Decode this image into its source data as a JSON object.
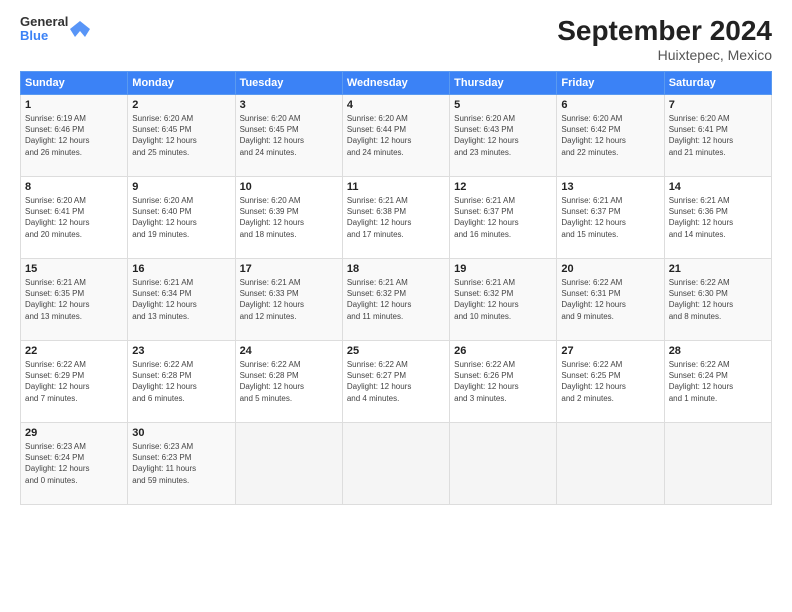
{
  "logo": {
    "text_general": "General",
    "text_blue": "Blue"
  },
  "header": {
    "month_title": "September 2024",
    "location": "Huixtepec, Mexico"
  },
  "days_header": [
    "Sunday",
    "Monday",
    "Tuesday",
    "Wednesday",
    "Thursday",
    "Friday",
    "Saturday"
  ],
  "weeks": [
    [
      {
        "day": "1",
        "sunrise": "6:19 AM",
        "sunset": "6:46 PM",
        "daylight": "12 hours and 26 minutes."
      },
      {
        "day": "2",
        "sunrise": "6:20 AM",
        "sunset": "6:45 PM",
        "daylight": "12 hours and 25 minutes."
      },
      {
        "day": "3",
        "sunrise": "6:20 AM",
        "sunset": "6:45 PM",
        "daylight": "12 hours and 24 minutes."
      },
      {
        "day": "4",
        "sunrise": "6:20 AM",
        "sunset": "6:44 PM",
        "daylight": "12 hours and 24 minutes."
      },
      {
        "day": "5",
        "sunrise": "6:20 AM",
        "sunset": "6:43 PM",
        "daylight": "12 hours and 23 minutes."
      },
      {
        "day": "6",
        "sunrise": "6:20 AM",
        "sunset": "6:42 PM",
        "daylight": "12 hours and 22 minutes."
      },
      {
        "day": "7",
        "sunrise": "6:20 AM",
        "sunset": "6:41 PM",
        "daylight": "12 hours and 21 minutes."
      }
    ],
    [
      {
        "day": "8",
        "sunrise": "6:20 AM",
        "sunset": "6:41 PM",
        "daylight": "12 hours and 20 minutes."
      },
      {
        "day": "9",
        "sunrise": "6:20 AM",
        "sunset": "6:40 PM",
        "daylight": "12 hours and 19 minutes."
      },
      {
        "day": "10",
        "sunrise": "6:20 AM",
        "sunset": "6:39 PM",
        "daylight": "12 hours and 18 minutes."
      },
      {
        "day": "11",
        "sunrise": "6:21 AM",
        "sunset": "6:38 PM",
        "daylight": "12 hours and 17 minutes."
      },
      {
        "day": "12",
        "sunrise": "6:21 AM",
        "sunset": "6:37 PM",
        "daylight": "12 hours and 16 minutes."
      },
      {
        "day": "13",
        "sunrise": "6:21 AM",
        "sunset": "6:37 PM",
        "daylight": "12 hours and 15 minutes."
      },
      {
        "day": "14",
        "sunrise": "6:21 AM",
        "sunset": "6:36 PM",
        "daylight": "12 hours and 14 minutes."
      }
    ],
    [
      {
        "day": "15",
        "sunrise": "6:21 AM",
        "sunset": "6:35 PM",
        "daylight": "12 hours and 13 minutes."
      },
      {
        "day": "16",
        "sunrise": "6:21 AM",
        "sunset": "6:34 PM",
        "daylight": "12 hours and 13 minutes."
      },
      {
        "day": "17",
        "sunrise": "6:21 AM",
        "sunset": "6:33 PM",
        "daylight": "12 hours and 12 minutes."
      },
      {
        "day": "18",
        "sunrise": "6:21 AM",
        "sunset": "6:32 PM",
        "daylight": "12 hours and 11 minutes."
      },
      {
        "day": "19",
        "sunrise": "6:21 AM",
        "sunset": "6:32 PM",
        "daylight": "12 hours and 10 minutes."
      },
      {
        "day": "20",
        "sunrise": "6:22 AM",
        "sunset": "6:31 PM",
        "daylight": "12 hours and 9 minutes."
      },
      {
        "day": "21",
        "sunrise": "6:22 AM",
        "sunset": "6:30 PM",
        "daylight": "12 hours and 8 minutes."
      }
    ],
    [
      {
        "day": "22",
        "sunrise": "6:22 AM",
        "sunset": "6:29 PM",
        "daylight": "12 hours and 7 minutes."
      },
      {
        "day": "23",
        "sunrise": "6:22 AM",
        "sunset": "6:28 PM",
        "daylight": "12 hours and 6 minutes."
      },
      {
        "day": "24",
        "sunrise": "6:22 AM",
        "sunset": "6:28 PM",
        "daylight": "12 hours and 5 minutes."
      },
      {
        "day": "25",
        "sunrise": "6:22 AM",
        "sunset": "6:27 PM",
        "daylight": "12 hours and 4 minutes."
      },
      {
        "day": "26",
        "sunrise": "6:22 AM",
        "sunset": "6:26 PM",
        "daylight": "12 hours and 3 minutes."
      },
      {
        "day": "27",
        "sunrise": "6:22 AM",
        "sunset": "6:25 PM",
        "daylight": "12 hours and 2 minutes."
      },
      {
        "day": "28",
        "sunrise": "6:22 AM",
        "sunset": "6:24 PM",
        "daylight": "12 hours and 1 minute."
      }
    ],
    [
      {
        "day": "29",
        "sunrise": "6:23 AM",
        "sunset": "6:24 PM",
        "daylight": "12 hours and 0 minutes."
      },
      {
        "day": "30",
        "sunrise": "6:23 AM",
        "sunset": "6:23 PM",
        "daylight": "11 hours and 59 minutes."
      },
      null,
      null,
      null,
      null,
      null
    ]
  ]
}
